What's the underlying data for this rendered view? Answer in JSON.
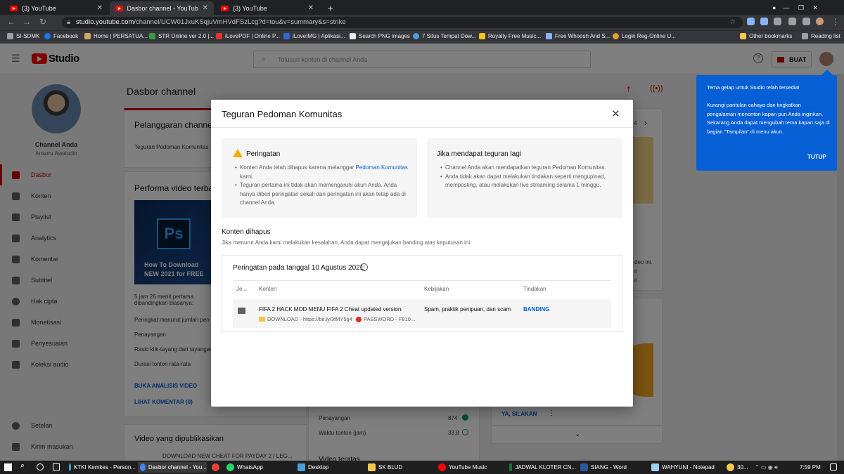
{
  "browser": {
    "tabs": [
      {
        "label": "(3) YouTube"
      },
      {
        "label": "Dasbor channel - YouTube Studio"
      },
      {
        "label": "(3) YouTube"
      }
    ],
    "new_tab": "+",
    "url_domain": "studio.youtube.com",
    "url_path": "/channel/UCW01JxuKSqjuVmHVdFSzLcg?d=tou&v=summary&s=strike",
    "bookmarks": [
      "SI-SDMK",
      "Facebook",
      "Home | PERSATUA...",
      "STR Online ver 2.0 |...",
      "iLovePDF | Online P...",
      "iLoveIMG | Aplikasi...",
      "Search PNG images",
      "7 Situs Tempat Dow...",
      "Royalty Free Music...",
      "Free Whoosh And S...",
      "Login Reg-Online U..."
    ],
    "other_bookmarks": "Other bookmarks",
    "reading_list": "Reading list"
  },
  "studio": {
    "logo_text": "Studio",
    "search_placeholder": "Telusuri konten di channel Anda",
    "create_label": "BUAT"
  },
  "sidebar": {
    "channel_label": "Channel Anda",
    "channel_name": "Ansoru Awaludin",
    "items": [
      {
        "label": "Dasbor",
        "icon": "dashboard-icon"
      },
      {
        "label": "Konten",
        "icon": "content-icon"
      },
      {
        "label": "Playlist",
        "icon": "playlist-icon"
      },
      {
        "label": "Analytics",
        "icon": "analytics-icon"
      },
      {
        "label": "Komentar",
        "icon": "comments-icon"
      },
      {
        "label": "Subtitel",
        "icon": "subtitles-icon"
      },
      {
        "label": "Hak cipta",
        "icon": "copyright-icon"
      },
      {
        "label": "Monetisasi",
        "icon": "monetization-icon"
      },
      {
        "label": "Penyesuaian",
        "icon": "customization-icon"
      },
      {
        "label": "Koleksi audio",
        "icon": "audio-library-icon"
      }
    ],
    "settings": "Setelan",
    "feedback": "Kirim masukan"
  },
  "main": {
    "page_title": "Dasbor channel",
    "card1_title": "Pelanggaran channel",
    "card1_text": "Teguran Pedoman Komunitas",
    "card2_title": "Performa video terbar",
    "video_thumb_text": "How To Download NEW 2021 for FREE",
    "video_meta": "5 jam 26 menit pertama dibandingkan biasanya:",
    "metrics": [
      "Peringkat menurut jumlah pen",
      "Penayangan",
      "Rasio klik-tayang dari tayangan",
      "Durasi tonton rata-rata"
    ],
    "link_analytics": "BUKA ANALISIS VIDEO",
    "link_comments": "LIHAT KOMENTAR (0)",
    "published_title": "Video yang dipublikasikan",
    "published_item": "DOWNLOAD NEW CHEAT FOR PAYDAY 2 / LEG...",
    "stat1_label": "Penayangan",
    "stat1_value": "874",
    "stat2_label": "Waktu tonton (jam)",
    "stat2_value": "33,8",
    "top_videos": "Video teratas",
    "right_link": "YA, SILAKAN",
    "right_text1": "deo ini.",
    "right_text2": "ri",
    "right_text3": "ri",
    "right_nav": "4"
  },
  "modal": {
    "title": "Teguran Pedoman Komunitas",
    "close": "✕",
    "warning_title": "Peringatan",
    "warning_b1_pre": "Konten Anda telah dihapus karena melanggar ",
    "warning_b1_link": "Pedoman Komunitas",
    "warning_b1_post": " kami.",
    "warning_b2": "Teguran pertama ini tidak akan memengaruhi akun Anda. Anda hanya diberi peringatan sekali dan peringatan ini akan tetap ada di channel Anda.",
    "strike_title": "Jika mendapat teguran lagi",
    "strike_b1": "Channel Anda akan mendapatkan teguran Pedoman Komunitas.",
    "strike_b2": "Anda tidak akan dapat melakukan tindakan seperti mengupload, memposting, atau melakukan live streaming selama 1 minggu.",
    "removed_title": "Konten dihapus",
    "removed_sub": "Jika menurut Anda kami melakukan kesalahan, Anda dapat mengajukan banding atas keputusan ini",
    "table_title": "Peringatan pada tanggal 10 Agustus 2021",
    "columns": [
      "Je...",
      "Konten",
      "Kebijakan",
      "Tindakan"
    ],
    "row": {
      "title": "FIFA 2 HACK MOD MENU FIFA 2 Cheat updated version",
      "desc": "DOWNLOAD - https://bit.ly/3fMY5g4",
      "desc2": "PASSWORD - F810...",
      "policy": "Spam, praktik penipuan, dan scam",
      "action": "BANDING"
    }
  },
  "notification": {
    "title": "Tema gelap untuk Studio telah tersedia!",
    "body": "Kurangi pantulan cahaya dan tingkatkan pengalaman menonton kapan pun Anda inginkan. Sekarang Anda dapat mengubah tema kapan saja di bagian \"Tampilan\" di menu akun.",
    "close_label": "TUTUP"
  },
  "taskbar": {
    "items": [
      "KTKI Kemkes - Person...",
      "Dasbor channel - You...",
      "WhatsApp",
      "Desktop",
      "SK BLUD",
      "YouTube Music",
      "JADWAL KLOTER CN...",
      "SIANG - Word",
      "WAHYUNI - Notepad"
    ],
    "weather": "30...",
    "time": "7:59 PM"
  }
}
